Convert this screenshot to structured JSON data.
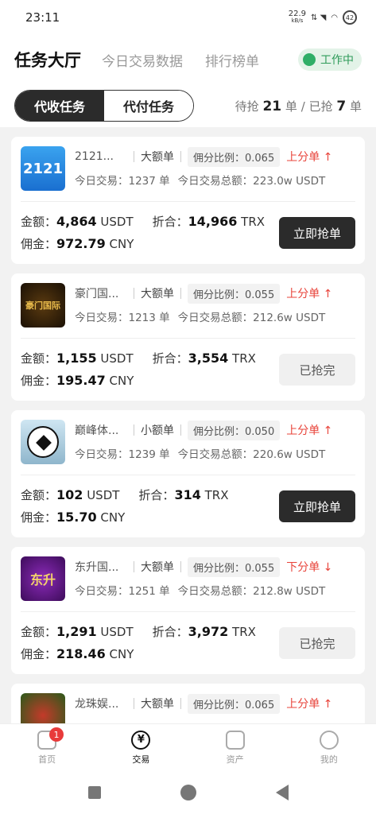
{
  "status": {
    "time": "23:11",
    "speed": "22.9",
    "speed_unit": "kB/s",
    "battery": "42"
  },
  "header": {
    "title": "任务大厅",
    "tabs": [
      "今日交易数据",
      "排行榜单"
    ],
    "status_label": "工作中"
  },
  "segments": {
    "active": "代收任务",
    "inactive": "代付任务"
  },
  "counts": {
    "pending_label": "待抢",
    "pending": "21",
    "unit": "单",
    "sep": "/",
    "taken_label": "已抢",
    "taken": "7"
  },
  "cards": [
    {
      "logo_text": "2121",
      "name": "2121...",
      "size": "大额单",
      "ratio": "佣分比例：0.065",
      "trend": "上分单 ↑",
      "today_count": "今日交易：1237 单",
      "today_total": "今日交易总额：223.0w USDT",
      "amount": "4,864",
      "amount_unit": "USDT",
      "convert": "14,966",
      "convert_unit": "TRX",
      "commission": "972.79",
      "commission_unit": "CNY",
      "button": "立即抢单",
      "state": "go"
    },
    {
      "logo_text": "豪门国际",
      "name": "豪门国...",
      "size": "大额单",
      "ratio": "佣分比例：0.055",
      "trend": "上分单 ↑",
      "today_count": "今日交易：1213 单",
      "today_total": "今日交易总额：212.6w USDT",
      "amount": "1,155",
      "amount_unit": "USDT",
      "convert": "3,554",
      "convert_unit": "TRX",
      "commission": "195.47",
      "commission_unit": "CNY",
      "button": "已抢完",
      "state": "done"
    },
    {
      "logo_text": "",
      "name": "巅峰体...",
      "size": "小额单",
      "ratio": "佣分比例：0.050",
      "trend": "上分单 ↑",
      "today_count": "今日交易：1239 单",
      "today_total": "今日交易总额：220.6w USDT",
      "amount": "102",
      "amount_unit": "USDT",
      "convert": "314",
      "convert_unit": "TRX",
      "commission": "15.70",
      "commission_unit": "CNY",
      "button": "立即抢单",
      "state": "go"
    },
    {
      "logo_text": "东升",
      "name": "东升国...",
      "size": "大额单",
      "ratio": "佣分比例：0.055",
      "trend": "下分单 ↓",
      "today_count": "今日交易：1251 单",
      "today_total": "今日交易总额：212.8w USDT",
      "amount": "1,291",
      "amount_unit": "USDT",
      "convert": "3,972",
      "convert_unit": "TRX",
      "commission": "218.46",
      "commission_unit": "CNY",
      "button": "已抢完",
      "state": "done"
    },
    {
      "logo_text": "",
      "name": "龙珠娱...",
      "size": "大额单",
      "ratio": "佣分比例：0.065",
      "trend": "上分单 ↑"
    }
  ],
  "labels": {
    "amount": "金额：",
    "convert": "折合：",
    "commission": "佣金："
  },
  "tabbar": [
    {
      "label": "首页",
      "icon": "home-icon",
      "badge": "1"
    },
    {
      "label": "交易",
      "icon": "yen-icon",
      "glyph": "¥"
    },
    {
      "label": "资产",
      "icon": "wallet-icon"
    },
    {
      "label": "我的",
      "icon": "user-icon"
    }
  ]
}
